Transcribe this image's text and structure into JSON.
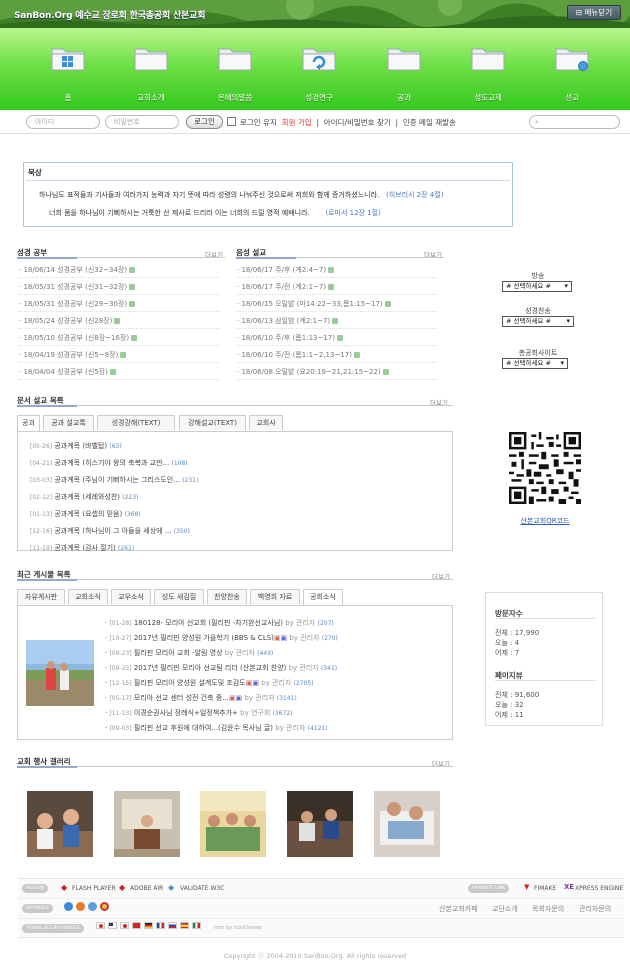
{
  "header": {
    "site_title": "SanBon.Org 예수교 장로회 한국총공회 산본교회",
    "menu_close": "메뉴닫기"
  },
  "nav": {
    "items": [
      {
        "label": "홈",
        "icon": "folder-windows-icon"
      },
      {
        "label": "교회소개",
        "icon": "folder-icon"
      },
      {
        "label": "은혜의말씀",
        "icon": "folder-icon"
      },
      {
        "label": "성경연구",
        "icon": "folder-refresh-icon"
      },
      {
        "label": "공과",
        "icon": "folder-icon"
      },
      {
        "label": "성도교제",
        "icon": "folder-icon"
      },
      {
        "label": "선교",
        "icon": "folder-globe-icon"
      }
    ]
  },
  "login": {
    "id_placeholder": "아이디",
    "pw_placeholder": "비밀번호",
    "login_button": "로그인",
    "keep_login": "로그인 유지",
    "signup": "회원 가입",
    "find": "아이디/비밀번호 찾기",
    "resend": "인증 메일 재발송",
    "sep": "|"
  },
  "meditation": {
    "title": "묵상",
    "verses": [
      {
        "text": "하나님도 표적들과 기사들과 여러가지 능력과  자기 뜻에 따라 성령의 나눠주신 것으로써 저희와 함께 증거하셨느니라.",
        "ref": "(히브리서 2장 4절)"
      },
      {
        "text": "너희 몸을 하나님이 기뻐하시는 거룩한 산 제사로 드리라 이는 너희의 드릴 영적 예배니라.",
        "ref": "(로마서 12장 1절)"
      }
    ]
  },
  "bible_study": {
    "title": "성경 공부",
    "more": "더보기",
    "items": [
      "18/06/14 성경공부 (신32~34장)",
      "18/05/31 성경공부 (신31~32장)",
      "18/05/31 성경공부 (신29~30장)",
      "18/05/24 성경공부 (신28장)",
      "18/05/10 성경공부 (신8장~16장)",
      "18/04/19 성경공부 (신5~8장)",
      "18/04/04 성경공부 (신5장)"
    ]
  },
  "audio_sermon": {
    "title": "음성 설교",
    "more": "더보기",
    "items": [
      "18/06/17 주/후 (계2:4~7)",
      "18/06/17 주/전 (계2:1~7)",
      "18/06/15 오밀밭 (마14:22~33,롬1:15~17)",
      "18/06/13 삼일밤 (계2:1~7)",
      "18/06/10 주/후 (롬1:13~17)",
      "18/06/10 주/전 (롬1:1~2,13~17)",
      "18/06/08 오밀밭 (요20:19~21,21:15~22)"
    ]
  },
  "side": {
    "broadcast_label": "방송",
    "hymn_label": "성경찬송",
    "site_label": "총공회사이트",
    "select_value": "# 선택하세요 #",
    "qr_caption": "산본교회QR코드"
  },
  "doc_sermon": {
    "title": "문서 설교 목록",
    "more": "더보기",
    "tabs": [
      "공과",
      "공과 설교록",
      "성경강해(TEXT)",
      "강해설교(TEXT)",
      "교회사"
    ],
    "items": [
      {
        "date": "[05-26]",
        "title": "공과계목 (바벨탑)",
        "count": "(63)"
      },
      {
        "date": "[04-21]",
        "title": "공과계목 (히스기야 왕의 축복과 교만...",
        "count": "(108)"
      },
      {
        "date": "[03-03]",
        "title": "공과계목 (주님이 기뻐하시는 그리스도인...",
        "count": "(231)"
      },
      {
        "date": "[02-12]",
        "title": "공과계목 (세례와성찬)",
        "count": "(223)"
      },
      {
        "date": "[01-13]",
        "title": "공과계목 (요셉의 믿음)",
        "count": "(368)"
      },
      {
        "date": "[12-16]",
        "title": "공과계목 (하나님이 그 아들을 세상에 ...",
        "count": "(350)"
      },
      {
        "date": "[11-19]",
        "title": "공과계목 (감사 절기)",
        "count": "(261)"
      }
    ]
  },
  "recent_posts": {
    "title": "최근 게시물 목록",
    "more": "더보기",
    "tabs": [
      "자유게시판",
      "교회소식",
      "교우소식",
      "성도 새김질",
      "찬양찬송",
      "백영희 자료",
      "공회소식"
    ],
    "items": [
      {
        "date": "[01-28]",
        "title": "180128- 모리아 선교회 (필리핀 -차기완선교사님)",
        "by": "by 관리자",
        "count": "(207)",
        "badge": false
      },
      {
        "date": "[10-27]",
        "title": "2017년 필리핀 양성원 가을학기 (BBS & CLS)",
        "by": "by 관리자",
        "count": "(270)",
        "badge": true
      },
      {
        "date": "[09-23]",
        "title": "필리핀 모리아 교회 -알림 영상",
        "by": "by 관리자",
        "count": "(449)",
        "badge": false
      },
      {
        "date": "[09-23]",
        "title": "2017년 필리핀 모리아 선교팀 리더 (산본교회 찬양)",
        "by": "by 관리자",
        "count": "(341)",
        "badge": false
      },
      {
        "date": "[12-15]",
        "title": "필리핀 모리아 양성원 설계도및 조감도",
        "by": "by 관리자",
        "count": "(2705)",
        "badge": true
      },
      {
        "date": "[05-17]",
        "title": "모리아 선교 센터 성전 건축 중...",
        "by": "by 관리자",
        "count": "(3141)",
        "badge": true
      },
      {
        "date": "[11-13]",
        "title": "이경순권사님 장례식+일정책추가+",
        "by": "by 연구회",
        "count": "(3672)",
        "badge": false
      },
      {
        "date": "[09-03]",
        "title": "필리핀 선교 후원에 대하여...(김윤수 목사님 글)",
        "by": "by 관리자",
        "count": "(4121)",
        "badge": false
      }
    ]
  },
  "stats": {
    "visitors_title": "방문자수",
    "visitors": [
      "전체 : 17,990",
      "오늘 : 4",
      "어제 : 7"
    ],
    "pageviews_title": "페이지뷰",
    "pageviews": [
      "전체 : 91,600",
      "오늘 : 32",
      "어제 : 11"
    ]
  },
  "gallery": {
    "title": "교회 행사 갤러리",
    "more": "더보기"
  },
  "footer": {
    "plugin_pill": "PLUG-IN",
    "plugins": [
      "FLASH PLAYER",
      "ADOBE AIR",
      "VALIDATE W3C"
    ],
    "favorite_pill": "FAVORITE LINK",
    "favorites": [
      "FIMAKE",
      "XPRESS ENGINE"
    ],
    "browser_pill": "BROWSER",
    "links": [
      "산본교회카페",
      "교단소개",
      "목회자문의",
      "관리자문의"
    ],
    "translate_pill": "TRANSLATE BY GOOGLE",
    "icon_credit": "Icon by iconDrawer",
    "copyright": "Copyright ⓒ 2004-2010 SanBon.Org. All rights reserved"
  },
  "colors": {
    "nav_green": "#6ee046",
    "accent_blue": "#4a7cc4",
    "signup_red": "#dd3333"
  }
}
